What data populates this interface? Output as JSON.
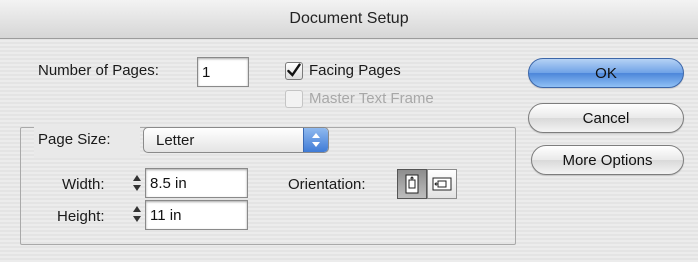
{
  "window": {
    "title": "Document Setup"
  },
  "pages": {
    "label": "Number of Pages:",
    "value": "1"
  },
  "facing_pages": {
    "label": "Facing Pages",
    "checked": true
  },
  "master_text_frame": {
    "label": "Master Text Frame",
    "checked": false,
    "enabled": false
  },
  "page_size": {
    "label": "Page Size:",
    "value": "Letter"
  },
  "width": {
    "label": "Width:",
    "value": "8.5 in"
  },
  "height": {
    "label": "Height:",
    "value": "11 in"
  },
  "orientation": {
    "label": "Orientation:",
    "selected": "portrait",
    "options": [
      "portrait",
      "landscape"
    ]
  },
  "buttons": {
    "ok": "OK",
    "cancel": "Cancel",
    "more_options": "More Options"
  },
  "colors": {
    "accent": "#4c86da",
    "disabled_text": "#a8a8a8"
  }
}
